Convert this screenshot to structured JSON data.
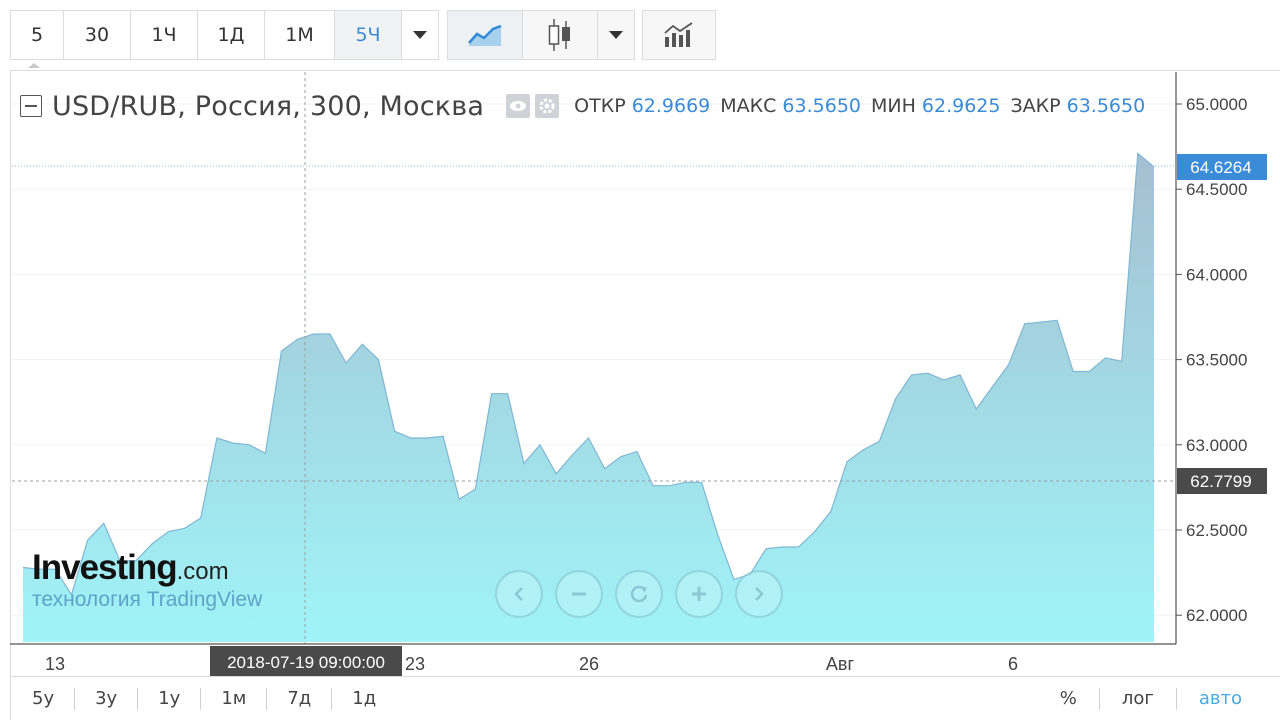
{
  "toolbar": {
    "intervals": [
      "5",
      "30",
      "1Ч",
      "1Д",
      "1М",
      "5Ч"
    ],
    "active_interval": "5Ч",
    "icons": [
      "chevron-down-icon",
      "line-chart-icon",
      "candlestick-icon",
      "chevron-down-icon",
      "indicators-icon"
    ]
  },
  "legend": {
    "title": "USD/RUB, Россия, 300, Москва",
    "open_label": "ОТКР",
    "open_value": "62.9669",
    "high_label": "МАКС",
    "high_value": "63.5650",
    "low_label": "МИН",
    "low_value": "62.9625",
    "close_label": "ЗАКР",
    "close_value": "63.5650"
  },
  "price_axis": {
    "ticks": [
      "65.0000",
      "64.5000",
      "64.0000",
      "63.5000",
      "63.0000",
      "62.5000",
      "62.0000"
    ],
    "last_price": "64.6264",
    "crosshair_price": "62.7799"
  },
  "time_axis": {
    "labels": [
      "13",
      "23",
      "26",
      "Авг",
      "6"
    ],
    "crosshair_time": "2018-07-19 09:00:00"
  },
  "period_bar": {
    "ranges": [
      "5у",
      "3у",
      "1у",
      "1м",
      "7д",
      "1д"
    ],
    "options": [
      "%",
      "лог",
      "авто"
    ],
    "active_option": "авто"
  },
  "watermark": {
    "brand": "Investing",
    "brand_suffix": ".com",
    "tech": "технология TradingView"
  },
  "colors": {
    "accent": "#3a8bd8",
    "area_top": "#a6bfd0",
    "area_bottom": "#9ff4f8",
    "line": "#7fb6d3",
    "crosshair_label": "#4a4a4a",
    "last_price_label": "#3a8bd8"
  },
  "chart_data": {
    "type": "area",
    "series": [
      {
        "values": [
          62.28,
          62.27,
          62.27,
          62.12,
          62.44,
          62.54,
          62.32,
          62.32,
          62.42,
          62.49,
          62.51,
          62.57,
          63.04,
          63.01,
          63.0,
          62.95,
          63.55,
          63.62,
          63.65,
          63.65,
          63.48,
          63.59,
          63.5,
          63.08,
          63.04,
          63.04,
          63.05,
          62.68,
          62.74,
          63.3,
          63.3,
          62.89,
          63.0,
          62.83,
          62.94,
          63.04,
          62.86,
          62.93,
          62.96,
          62.76,
          62.76,
          62.78,
          62.78,
          62.47,
          62.21,
          62.24,
          62.39,
          62.4,
          62.4,
          62.49,
          62.61,
          62.9,
          62.97,
          63.02,
          63.27,
          63.41,
          63.42,
          63.38,
          63.41,
          63.21,
          63.34,
          63.47,
          63.71,
          63.72,
          63.73,
          63.43,
          63.43,
          63.51,
          63.49,
          64.71,
          64.63
        ]
      }
    ],
    "ylim": [
      61.9,
      65.2
    ]
  }
}
